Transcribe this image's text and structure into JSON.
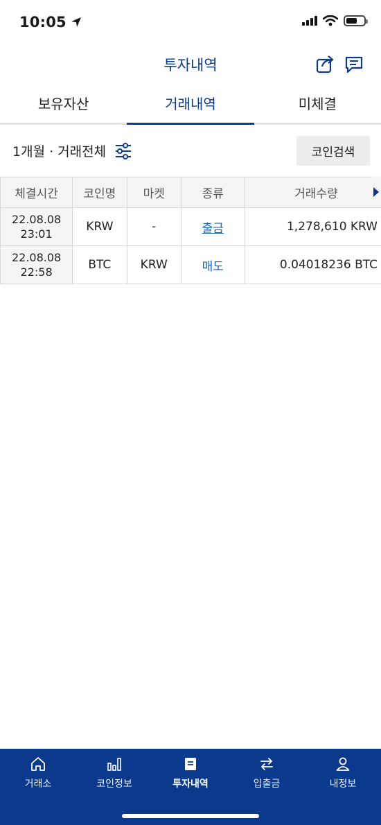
{
  "status_bar": {
    "time": "10:05"
  },
  "header": {
    "title": "투자내역"
  },
  "tabs": [
    {
      "label": "보유자산"
    },
    {
      "label": "거래내역",
      "active": true
    },
    {
      "label": "미체결"
    }
  ],
  "filter": {
    "label": "1개월 · 거래전체",
    "search_button": "코인검색"
  },
  "table": {
    "headers": [
      "체결시간",
      "코인명",
      "마켓",
      "종류",
      "거래수량"
    ],
    "rows": [
      {
        "date": "22.08.08",
        "time": "23:01",
        "coin": "KRW",
        "market": "-",
        "kind": "출금",
        "amount": "1,278,610 KRW"
      },
      {
        "date": "22.08.08",
        "time": "22:58",
        "coin": "BTC",
        "market": "KRW",
        "kind": "매도",
        "amount": "0.04018236 BTC"
      }
    ]
  },
  "bottom_nav": [
    {
      "label": "거래소",
      "icon": "home-icon"
    },
    {
      "label": "코인정보",
      "icon": "bar-chart-icon"
    },
    {
      "label": "투자내역",
      "icon": "document-icon",
      "active": true
    },
    {
      "label": "입출금",
      "icon": "transfer-icon"
    },
    {
      "label": "내정보",
      "icon": "user-icon"
    }
  ],
  "colors": {
    "brand": "#0b3a8c",
    "link": "#1b5fb0",
    "header_bg": "#f4f4f4"
  }
}
